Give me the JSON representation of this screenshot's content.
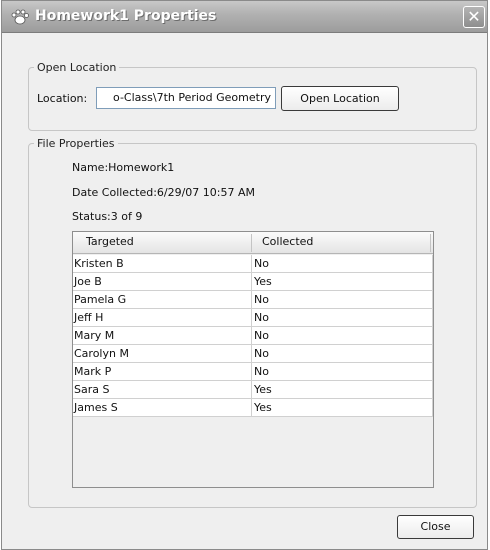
{
  "window": {
    "title": "Homework1 Properties",
    "icon": "paw-print-icon",
    "close_glyph": "✕"
  },
  "open_location": {
    "legend": "Open Location",
    "location_label": "Location:",
    "location_value": "o-Class\\7th Period Geometry",
    "open_button": "Open Location"
  },
  "file_properties": {
    "legend": "File Properties",
    "name": "Name:Homework1",
    "date_collected": "Date Collected:6/29/07 10:57 AM",
    "status": "Status:3 of 9"
  },
  "table": {
    "columns": [
      "Targeted",
      "Collected"
    ],
    "rows": [
      {
        "targeted": "Kristen B",
        "collected": "No"
      },
      {
        "targeted": "Joe B",
        "collected": "Yes"
      },
      {
        "targeted": "Pamela G",
        "collected": "No"
      },
      {
        "targeted": "Jeff H",
        "collected": "No"
      },
      {
        "targeted": "Mary M",
        "collected": "No"
      },
      {
        "targeted": "Carolyn M",
        "collected": "No"
      },
      {
        "targeted": "Mark P",
        "collected": "No"
      },
      {
        "targeted": "Sara S",
        "collected": "Yes"
      },
      {
        "targeted": "James S",
        "collected": "Yes"
      }
    ]
  },
  "footer": {
    "close_button": "Close"
  }
}
